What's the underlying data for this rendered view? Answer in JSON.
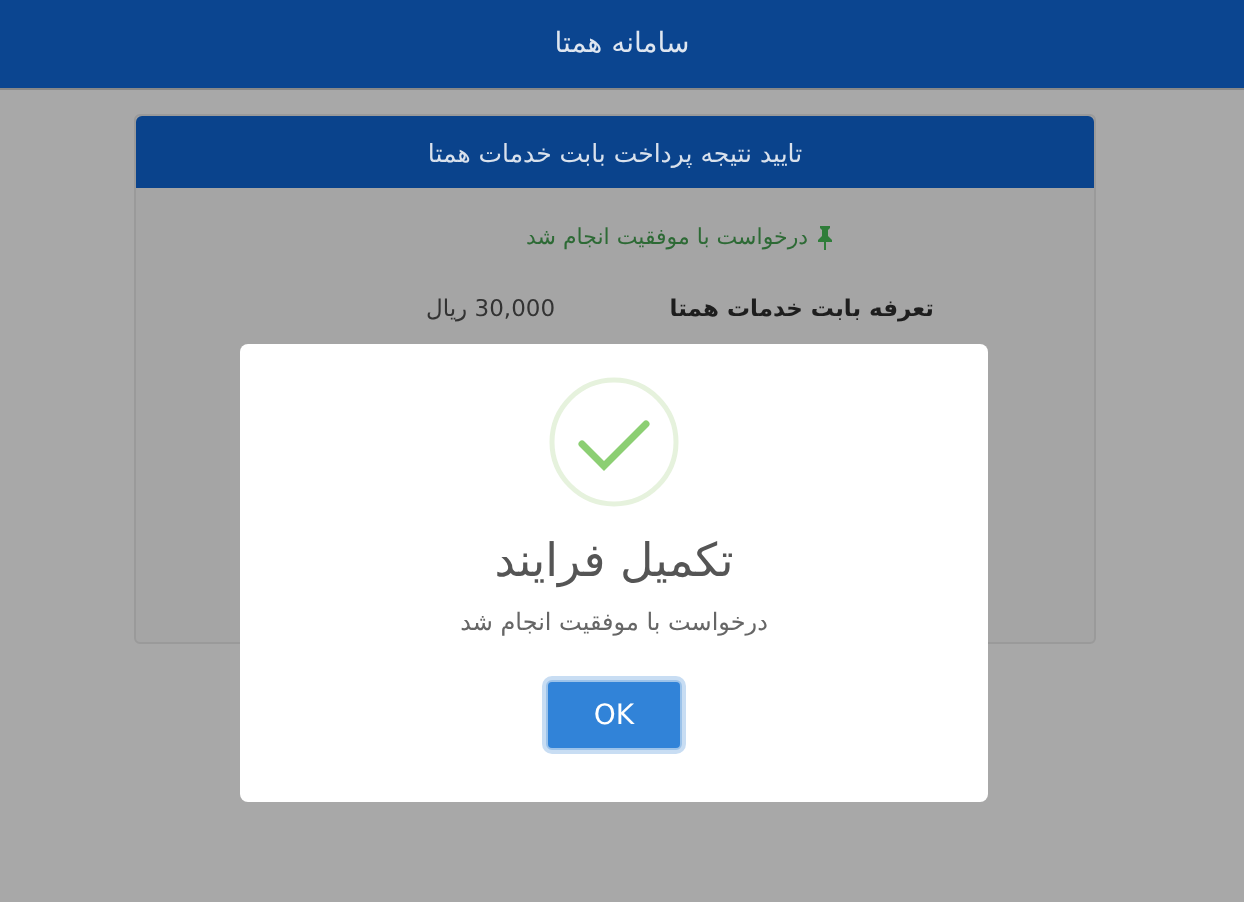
{
  "header": {
    "title": "سامانه همتا"
  },
  "card": {
    "title": "تایید نتیجه پرداخت بابت خدمات همتا",
    "notice": "درخواست با موفقیت انجام شد",
    "rows": [
      {
        "label": "تعرفه بابت خدمات همتا",
        "value": "30,000 ریال"
      }
    ]
  },
  "dialog": {
    "title": "تکمیل فرایند",
    "message": "درخواست با موفقیت انجام شد",
    "buttons": [
      "OK"
    ]
  }
}
